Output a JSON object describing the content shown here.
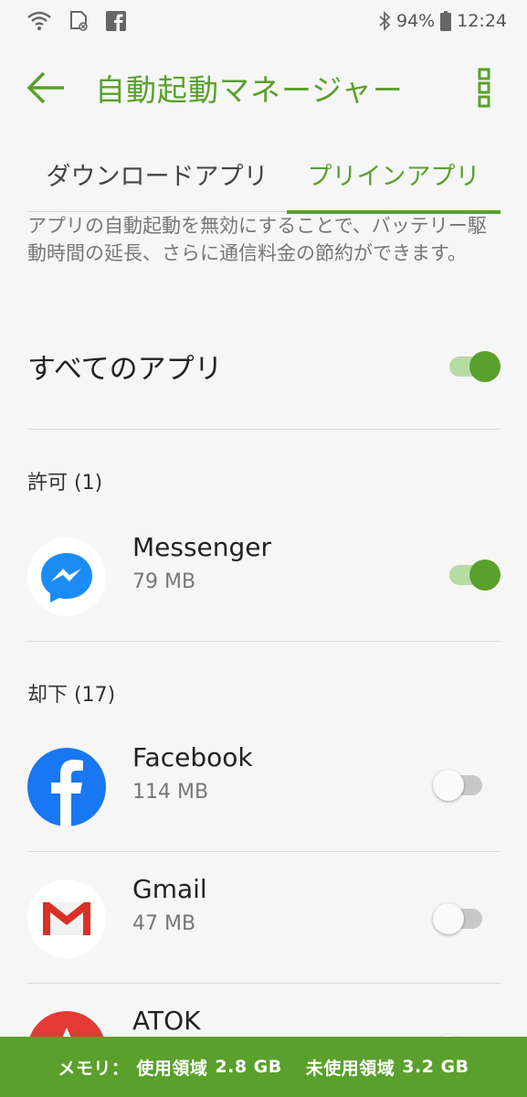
{
  "status_bar": {
    "battery": "94%",
    "time": "12:24",
    "icons": [
      "wifi-icon",
      "sd-card-icon",
      "facebook-icon",
      "bluetooth-icon",
      "battery-icon"
    ]
  },
  "app_bar": {
    "title": "自動起動マネージャー",
    "accent_color": "#5aa02c"
  },
  "tabs": [
    {
      "label": "ダウンロードアプリ",
      "selected": false
    },
    {
      "label": "プリインアプリ",
      "selected": true
    }
  ],
  "description": "アプリの自動起動を無効にすることで、バッテリー駆動時間の延長、さらに通信料金の節約ができます。",
  "all_apps": {
    "label": "すべてのアプリ",
    "enabled": true
  },
  "sections": [
    {
      "header": "許可 (1)",
      "apps": [
        {
          "name": "Messenger",
          "size": "79 MB",
          "enabled": true,
          "icon": "messenger-icon"
        }
      ]
    },
    {
      "header": "却下 (17)",
      "apps": [
        {
          "name": "Facebook",
          "size": "114 MB",
          "enabled": false,
          "icon": "facebook-app-icon"
        },
        {
          "name": "Gmail",
          "size": "47 MB",
          "enabled": false,
          "icon": "gmail-icon"
        },
        {
          "name": "ATOK",
          "size": "",
          "enabled": false,
          "icon": "atok-icon"
        }
      ]
    }
  ],
  "footer": {
    "memory_label": "メモリ：",
    "used_label": "使用領域",
    "used_value": "2.8 GB",
    "free_label": "未使用領域",
    "free_value": "3.2 GB"
  }
}
